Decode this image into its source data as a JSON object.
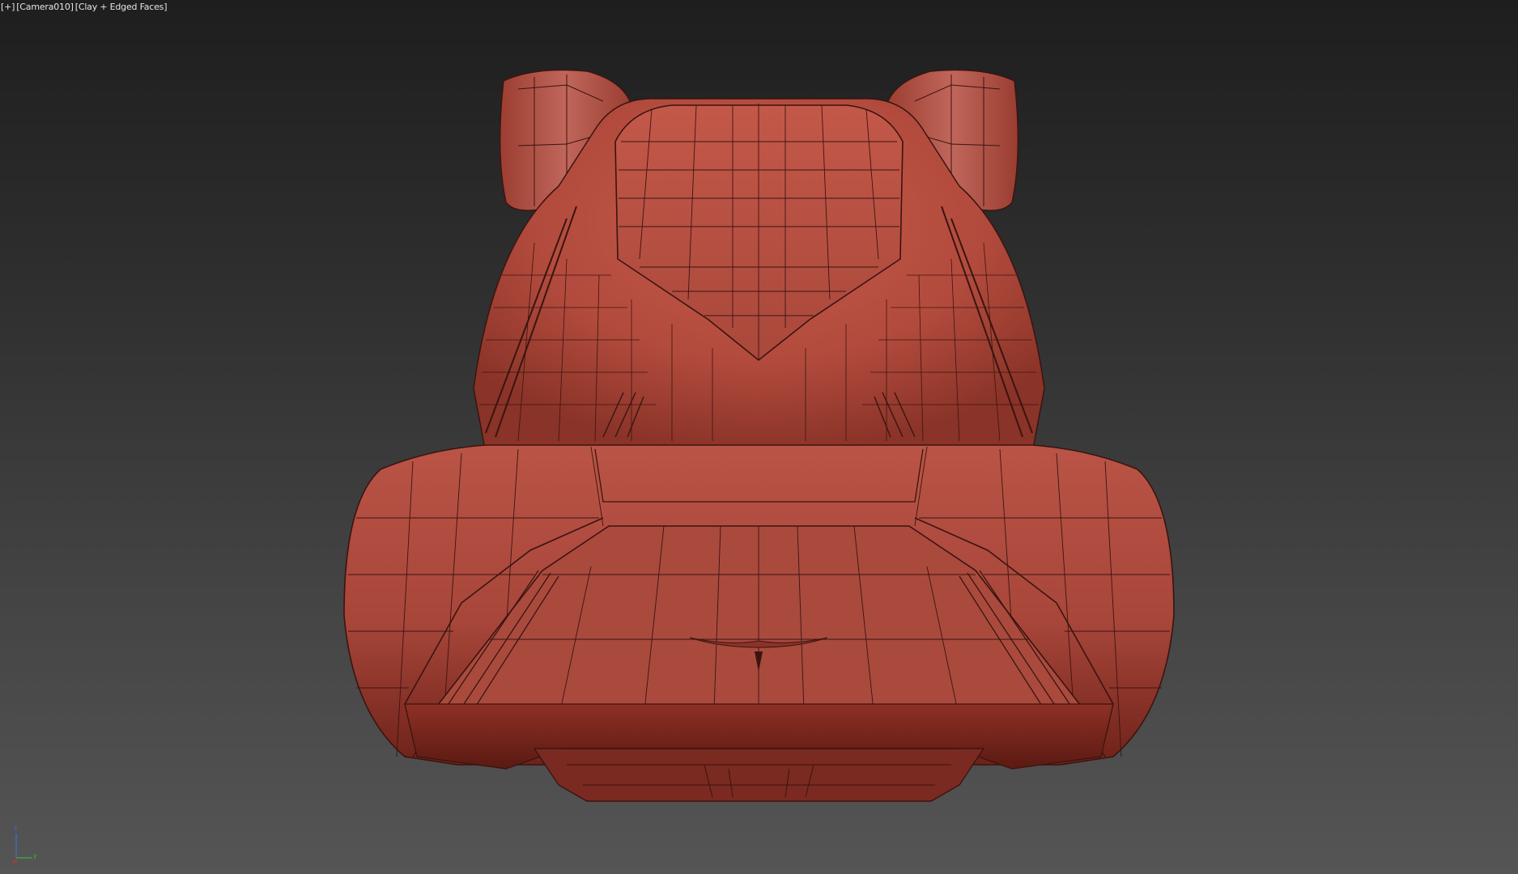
{
  "viewport": {
    "menu_plus": "[+]",
    "camera": "[Camera010]",
    "shading": "[Clay + Edged Faces]"
  },
  "object": {
    "description_icon": "car-body-clay-mesh",
    "colors": {
      "clay_base": "#b04a3c",
      "clay_light": "#c8584a",
      "clay_shadow": "#7a2a20",
      "edge_lines": "#3a1410"
    }
  },
  "axis_gizmo": {
    "z": "z",
    "x": "x",
    "y": "y",
    "colors": {
      "x": "#c0392b",
      "y": "#3fae49",
      "z": "#3b6fd8"
    }
  }
}
